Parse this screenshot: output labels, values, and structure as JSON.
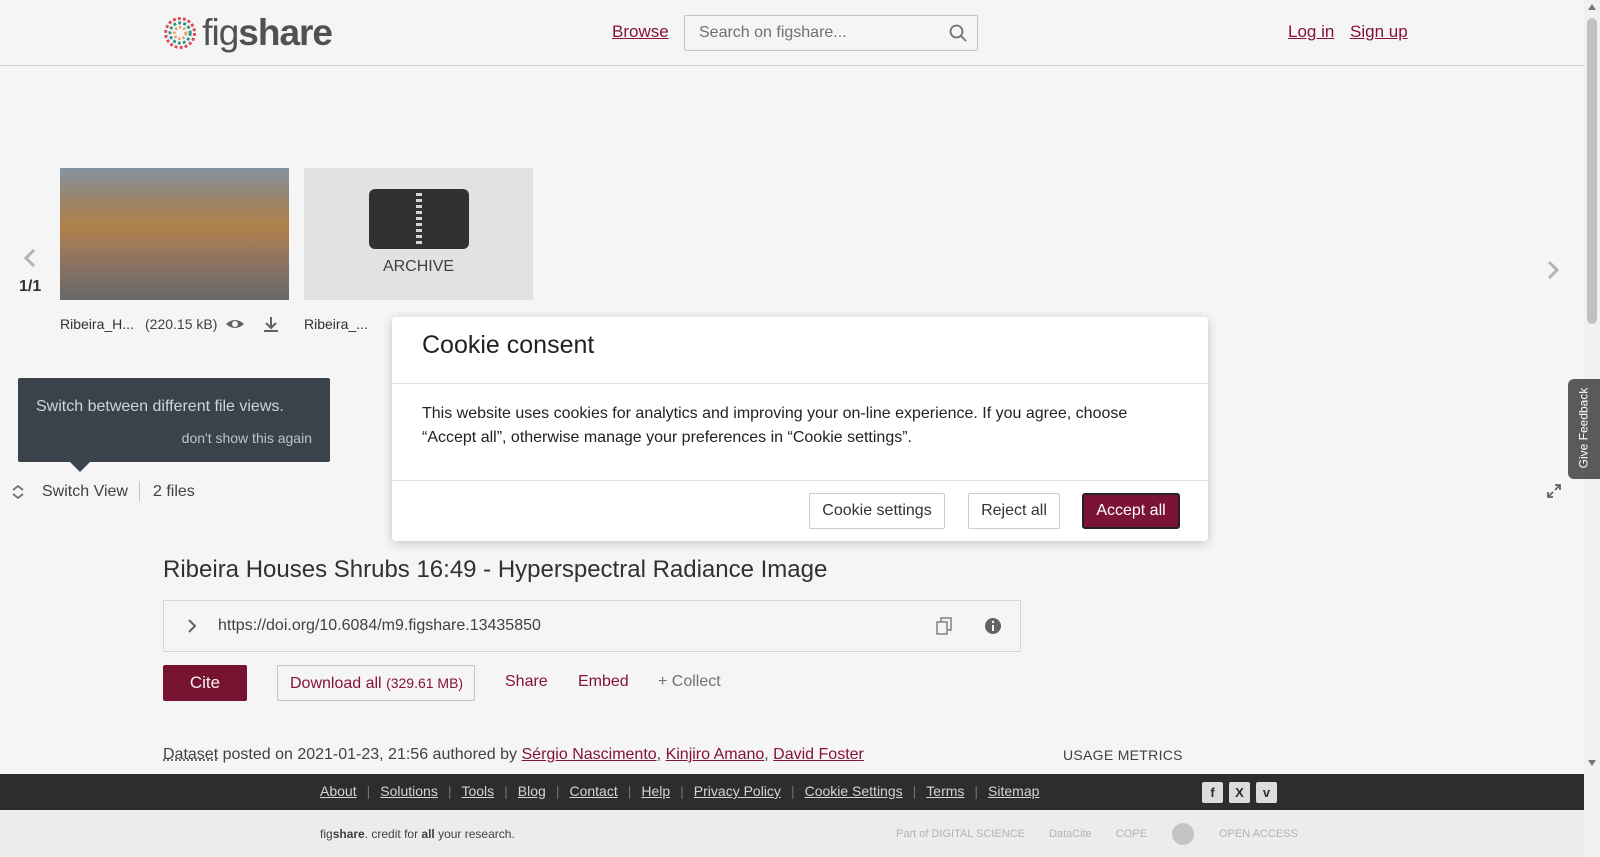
{
  "header": {
    "logo_prefix": "fig",
    "logo_suffix": "share",
    "browse": "Browse",
    "search_placeholder": "Search on figshare...",
    "login": "Log in",
    "signup": "Sign up"
  },
  "viewer": {
    "pager": "1/1",
    "files": [
      {
        "name": "Ribeira_H...",
        "size": "(220.15 kB)"
      },
      {
        "name": "Ribeira_...",
        "type_label": "ARCHIVE"
      }
    ],
    "tooltip_text": "Switch between different file views.",
    "tooltip_dismiss": "don't show this again",
    "switch_view": "Switch View",
    "file_count": "2 files"
  },
  "item": {
    "title": "Ribeira Houses Shrubs 16:49 - Hyperspectral Radiance Image",
    "doi": "https://doi.org/10.6084/m9.figshare.13435850",
    "cite": "Cite",
    "download_all": "Download all",
    "download_size": "(329.61 MB)",
    "share": "Share",
    "embed": "Embed",
    "collect": "+ Collect",
    "type": "Dataset",
    "posted_text": "posted on 2021-01-23, 21:56 authored by",
    "authors": [
      "Sérgio Nascimento",
      "Kinjiro Amano",
      "David Foster"
    ],
    "usage_metrics": "USAGE METRICS"
  },
  "footer": {
    "links": [
      "About",
      "Solutions",
      "Tools",
      "Blog",
      "Contact",
      "Help",
      "Privacy Policy",
      "Cookie Settings",
      "Terms",
      "Sitemap"
    ],
    "tagline_prefix": "fig",
    "tagline_bold": "share",
    "tagline_mid": ". credit for ",
    "tagline_all": "all",
    "tagline_end": " your research.",
    "partners": [
      "Part of DIGITAL SCIENCE",
      "DataCite",
      "COPE",
      "",
      "OPEN ACCESS"
    ],
    "social_icons": [
      "facebook-icon",
      "x-icon",
      "vimeo-icon"
    ]
  },
  "feedback": "Give Feedback",
  "cookie_modal": {
    "title": "Cookie consent",
    "body": "This website uses cookies for analytics and improving your on-line experience. If you agree, choose “Accept all”, otherwise manage your preferences in “Cookie settings”.",
    "settings": "Cookie settings",
    "reject": "Reject all",
    "accept": "Accept all"
  },
  "colors": {
    "brand": "#7b1434",
    "link": "#8b1538",
    "footer_dark": "#2f2f2f"
  }
}
